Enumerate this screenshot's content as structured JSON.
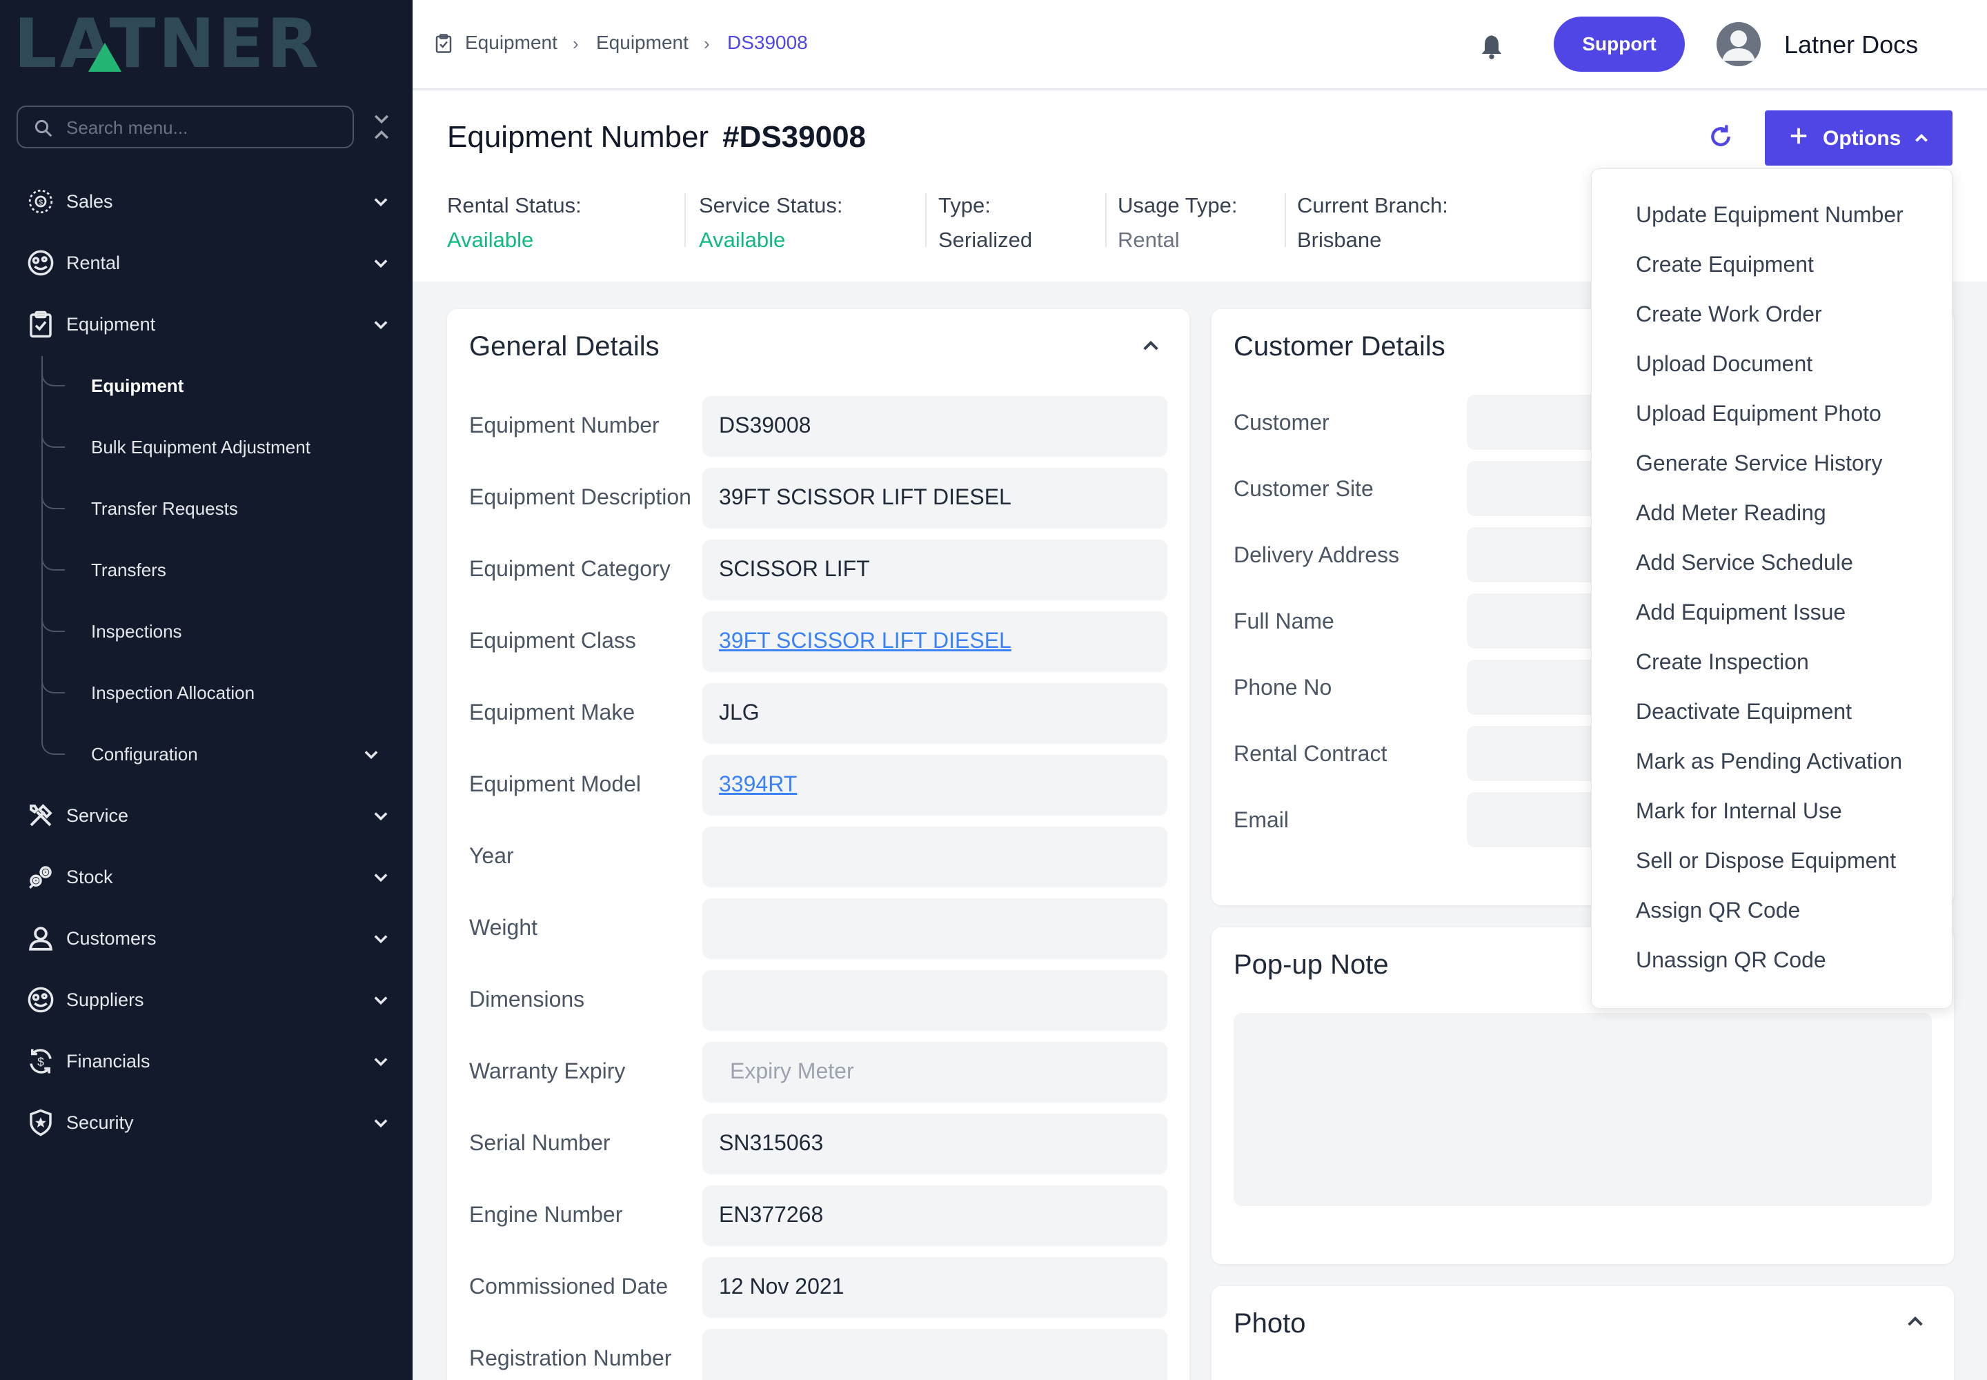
{
  "brand": {
    "logo_text": "LATNER"
  },
  "colors": {
    "accent": "#4f46e5",
    "sidebar_bg": "#121a2c",
    "available": "#10b981",
    "link": "#3b82f6",
    "logo_green": "#22b573"
  },
  "sidebar": {
    "search_placeholder": "Search menu...",
    "items": [
      {
        "label": "Sales",
        "icon": "sales-icon"
      },
      {
        "label": "Rental",
        "icon": "rental-icon"
      },
      {
        "label": "Equipment",
        "icon": "clipboard-icon"
      },
      {
        "label": "Service",
        "icon": "tools-icon"
      },
      {
        "label": "Stock",
        "icon": "stock-icon"
      },
      {
        "label": "Customers",
        "icon": "user-icon"
      },
      {
        "label": "Suppliers",
        "icon": "suppliers-icon"
      },
      {
        "label": "Financials",
        "icon": "dollar-cycle-icon"
      },
      {
        "label": "Security",
        "icon": "shield-icon"
      }
    ],
    "equipment_sub": [
      {
        "label": "Equipment",
        "active": true
      },
      {
        "label": "Bulk Equipment Adjustment"
      },
      {
        "label": "Transfer Requests"
      },
      {
        "label": "Transfers"
      },
      {
        "label": "Inspections"
      },
      {
        "label": "Inspection Allocation"
      },
      {
        "label": "Configuration"
      }
    ]
  },
  "topbar": {
    "breadcrumb": [
      "Equipment",
      "Equipment",
      "DS39008"
    ],
    "support_label": "Support",
    "user_name": "Latner Docs"
  },
  "header": {
    "title_prefix": "Equipment Number",
    "title_number": "#DS39008",
    "options_label": "Options",
    "stats": [
      {
        "label": "Rental Status:",
        "value": "Available"
      },
      {
        "label": "Service Status:",
        "value": "Available"
      },
      {
        "label": "Type:",
        "value": "Serialized"
      },
      {
        "label": "Usage Type:",
        "value": "Rental"
      },
      {
        "label": "Current Branch:",
        "value": "Brisbane"
      }
    ]
  },
  "general": {
    "title": "General Details",
    "fields": [
      {
        "label": "Equipment Number",
        "value": "DS39008"
      },
      {
        "label": "Equipment Description",
        "value": "39FT SCISSOR LIFT DIESEL"
      },
      {
        "label": "Equipment Category",
        "value": "SCISSOR LIFT"
      },
      {
        "label": "Equipment Class",
        "value": "39FT SCISSOR LIFT DIESEL"
      },
      {
        "label": "Equipment Make",
        "value": "JLG"
      },
      {
        "label": "Equipment Model",
        "value": "3394RT"
      },
      {
        "label": "Year",
        "value": ""
      },
      {
        "label": "Weight",
        "value": ""
      },
      {
        "label": "Dimensions",
        "value": ""
      },
      {
        "label": "Warranty Expiry",
        "value": "",
        "placeholder": "Expiry Meter"
      },
      {
        "label": "Serial Number",
        "value": "SN315063"
      },
      {
        "label": "Engine Number",
        "value": "EN377268"
      },
      {
        "label": "Commissioned Date",
        "value": "12 Nov 2021"
      },
      {
        "label": "Registration Number",
        "value": ""
      }
    ]
  },
  "customer": {
    "title": "Customer Details",
    "fields": [
      "Customer",
      "Customer Site",
      "Delivery Address",
      "Full Name",
      "Phone No",
      "Rental Contract",
      "Email"
    ]
  },
  "popup_note": {
    "title": "Pop-up Note"
  },
  "photo": {
    "title": "Photo"
  },
  "options_menu": [
    "Update Equipment Number",
    "Create Equipment",
    "Create Work Order",
    "Upload Document",
    "Upload Equipment Photo",
    "Generate Service History",
    "Add Meter Reading",
    "Add Service Schedule",
    "Add Equipment Issue",
    "Create Inspection",
    "Deactivate Equipment",
    "Mark as Pending Activation",
    "Mark for Internal Use",
    "Sell or Dispose Equipment",
    "Assign QR Code",
    "Unassign QR Code"
  ]
}
